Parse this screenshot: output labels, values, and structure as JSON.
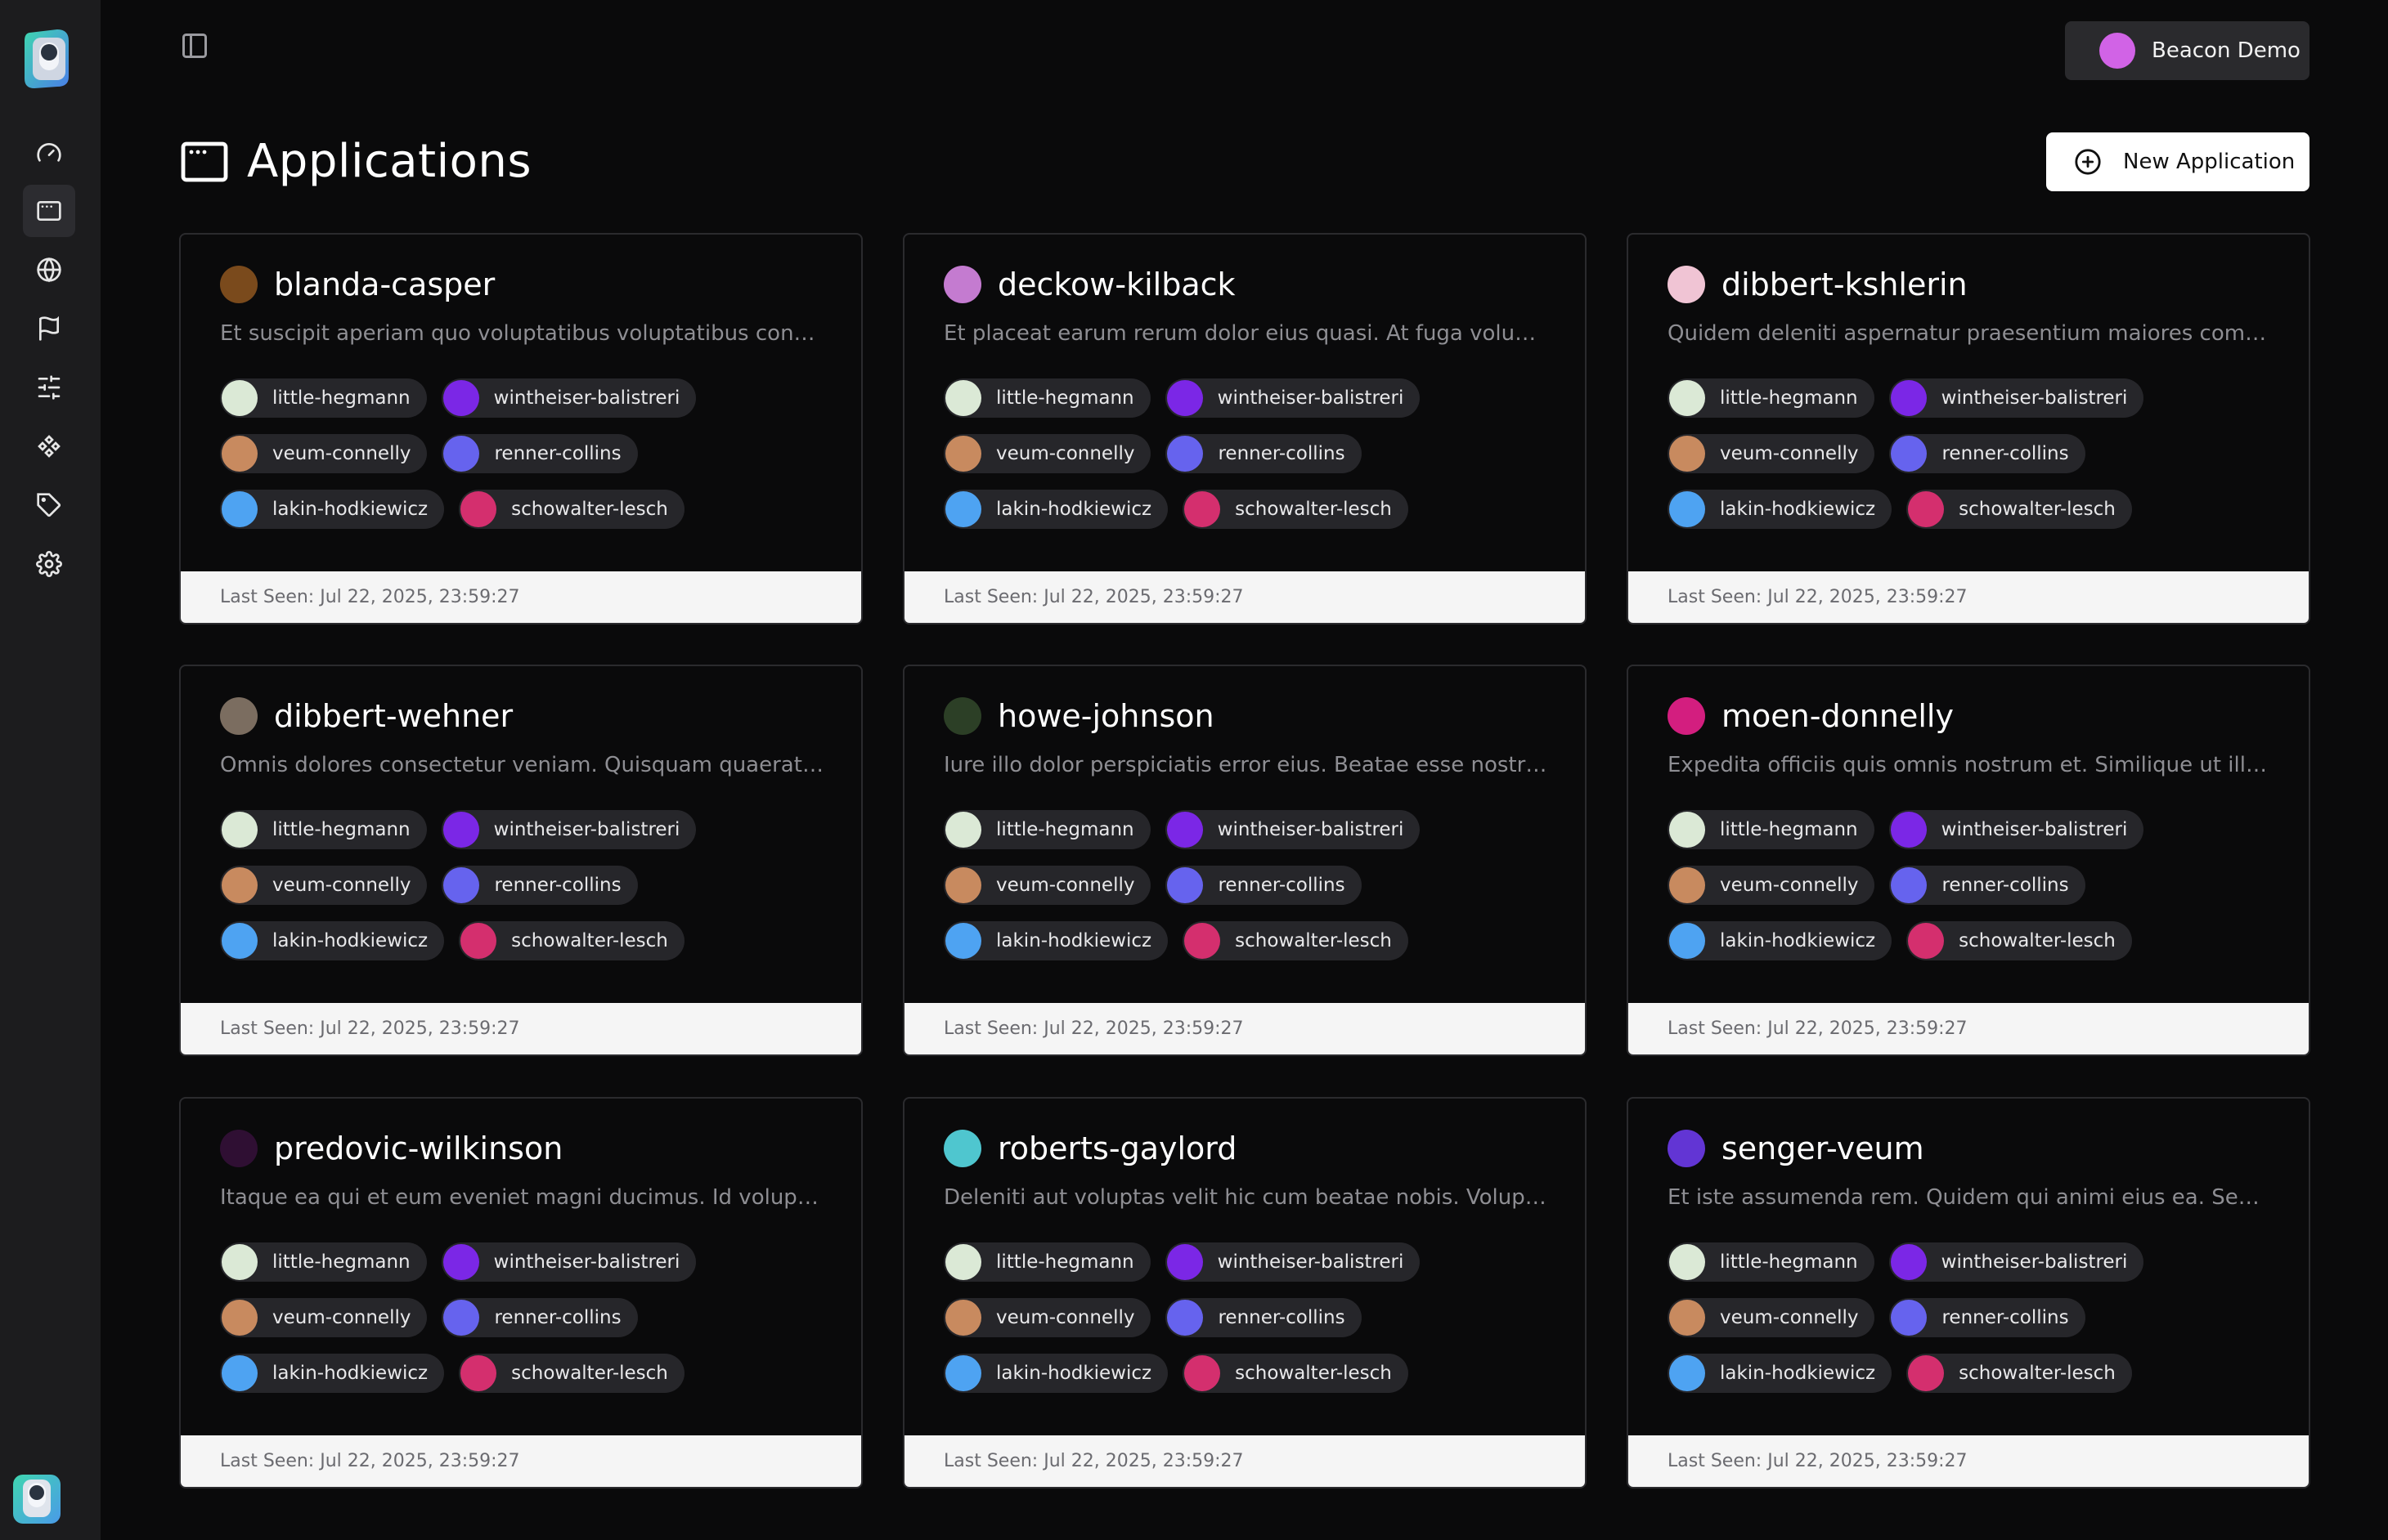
{
  "user": {
    "name": "Beacon Demo",
    "color": "#d163e6"
  },
  "page": {
    "title": "Applications",
    "new_button": "New Application"
  },
  "nav": [
    {
      "icon": "gauge-icon",
      "active": false
    },
    {
      "icon": "app-window-icon",
      "active": true
    },
    {
      "icon": "globe-icon",
      "active": false
    },
    {
      "icon": "flag-icon",
      "active": false
    },
    {
      "icon": "sliders-icon",
      "active": false
    },
    {
      "icon": "components-icon",
      "active": false
    },
    {
      "icon": "tag-icon",
      "active": false
    },
    {
      "icon": "settings-icon",
      "active": false
    }
  ],
  "tag_colors": {
    "little-hegmann": "#dbe9d6",
    "wintheiser-balistreri": "#7b27e6",
    "veum-connelly": "#c88a5f",
    "renner-collins": "#6663ee",
    "lakin-hodkiewicz": "#4ea3f2",
    "schowalter-lesch": "#d42f6e"
  },
  "tag_rows": [
    [
      "little-hegmann",
      "wintheiser-balistreri"
    ],
    [
      "veum-connelly",
      "renner-collins"
    ],
    [
      "lakin-hodkiewicz",
      "schowalter-lesch"
    ]
  ],
  "applications": [
    {
      "name": "blanda-casper",
      "color": "#7a4a1c",
      "description": "Et suscipit aperiam quo voluptatibus voluptatibus consequatur. Quia",
      "last_seen": "Last Seen: Jul 22, 2025, 23:59:27"
    },
    {
      "name": "deckow-kilback",
      "color": "#c47bd0",
      "description": "Et placeat earum rerum dolor eius quasi. At fuga voluptas accusamus",
      "last_seen": "Last Seen: Jul 22, 2025, 23:59:27"
    },
    {
      "name": "dibbert-kshlerin",
      "color": "#f0c4d4",
      "description": "Quidem deleniti aspernatur praesentium maiores commodi eveniet",
      "last_seen": "Last Seen: Jul 22, 2025, 23:59:27"
    },
    {
      "name": "dibbert-wehner",
      "color": "#7b6d60",
      "description": "Omnis dolores consectetur veniam. Quisquam quaerat eum laborum",
      "last_seen": "Last Seen: Jul 22, 2025, 23:59:27"
    },
    {
      "name": "howe-johnson",
      "color": "#2c3f26",
      "description": "Iure illo dolor perspiciatis error eius. Beatae esse nostrum laborum",
      "last_seen": "Last Seen: Jul 22, 2025, 23:59:27"
    },
    {
      "name": "moen-donnelly",
      "color": "#d31e7f",
      "description": "Expedita officiis quis omnis nostrum et. Similique ut illo beatae",
      "last_seen": "Last Seen: Jul 22, 2025, 23:59:27"
    },
    {
      "name": "predovic-wilkinson",
      "color": "#2f0f33",
      "description": "Itaque ea qui et eum eveniet magni ducimus. Id voluptatem veniam",
      "last_seen": "Last Seen: Jul 22, 2025, 23:59:27"
    },
    {
      "name": "roberts-gaylord",
      "color": "#4fc6cf",
      "description": "Deleniti aut voluptas velit hic cum beatae nobis. Voluptatibus minus",
      "last_seen": "Last Seen: Jul 22, 2025, 23:59:27"
    },
    {
      "name": "senger-veum",
      "color": "#6235d4",
      "description": "Et iste assumenda rem. Quidem qui animi eius ea. Sed nesciunt amet",
      "last_seen": "Last Seen: Jul 22, 2025, 23:59:27"
    }
  ]
}
